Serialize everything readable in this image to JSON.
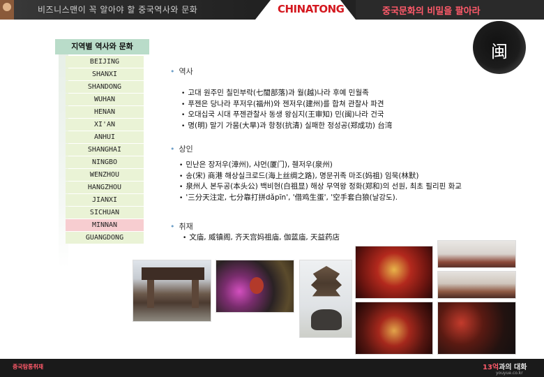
{
  "header": {
    "slogan_left": "비즈니스맨이 꼭 알아야 할 중국역사와 문화",
    "logo": "CHINATONG",
    "slogan_right": "중국문화의 비밀을 팔아라"
  },
  "emblem": {
    "character": "闽"
  },
  "sidebar": {
    "title": "지역별 역사와 문화",
    "items": [
      {
        "label": "BEIJING"
      },
      {
        "label": "SHANXI"
      },
      {
        "label": "SHANDONG"
      },
      {
        "label": "WUHAN"
      },
      {
        "label": "HENAN"
      },
      {
        "label": "XI'AN"
      },
      {
        "label": "ANHUI"
      },
      {
        "label": "SHANGHAI"
      },
      {
        "label": "NINGBO"
      },
      {
        "label": "WENZHOU"
      },
      {
        "label": "HANGZHOU"
      },
      {
        "label": "JIANXI"
      },
      {
        "label": "SICHUAN"
      },
      {
        "label": "MINNAN"
      },
      {
        "label": "GUANGDONG"
      }
    ],
    "active": "MINNAN"
  },
  "sections": {
    "history": {
      "title": "역사",
      "bullets": [
        "고대 원주민 칠민부락(七閩部落)과 월(越)나라 후예 민월족",
        "푸젠은 당나라 푸저우(福州)와 젠저우(建州)를 합쳐 관찰사 파견",
        "오대십국 시대 푸젠관찰사 동생 왕심지(王审知) 민(闽)나라 건국",
        "명(明) 말기 가뭄(大旱)과 항청(抗清) 실패한 정성공(郑成功) 台湾"
      ]
    },
    "merchant": {
      "title": "상인",
      "bullets": [
        "민난은 장저우(漳州), 샤먼(厦门), 췐저우(泉州)",
        "송(宋) 商港 해상실크로드(海上丝绸之路), 명문귀족 마조(妈祖) 임묵(林默)",
        "泉州人 본두공(本头公) 백비현(白祖显) 해상 무역왕 정화(郑和)의 선원, 최초 필리핀 화교",
        "'三分天注定, 七分靠打拼dǎpīn', '借鸡生蛋', '空手套白狼(날강도)."
      ]
    },
    "coverage": {
      "title": "취재",
      "bullets": [
        "文庙, 威镇阁, 齐天宫妈祖庙, 伽蓝庙, 天益药店"
      ]
    }
  },
  "footer": {
    "left": "중국탐통취재",
    "logo_num": "13억",
    "logo_text": "과의 대화",
    "url": "youyue.co.kr"
  },
  "colors": {
    "header_bg": "#1b1b1b",
    "logo_red": "#d41920",
    "sidebar_title_bg": "#b9dcc9",
    "sidebar_item_bg": "#eaf3d6",
    "sidebar_active_bg": "#f7cdd0",
    "section_dot": "#6fa0c8"
  }
}
